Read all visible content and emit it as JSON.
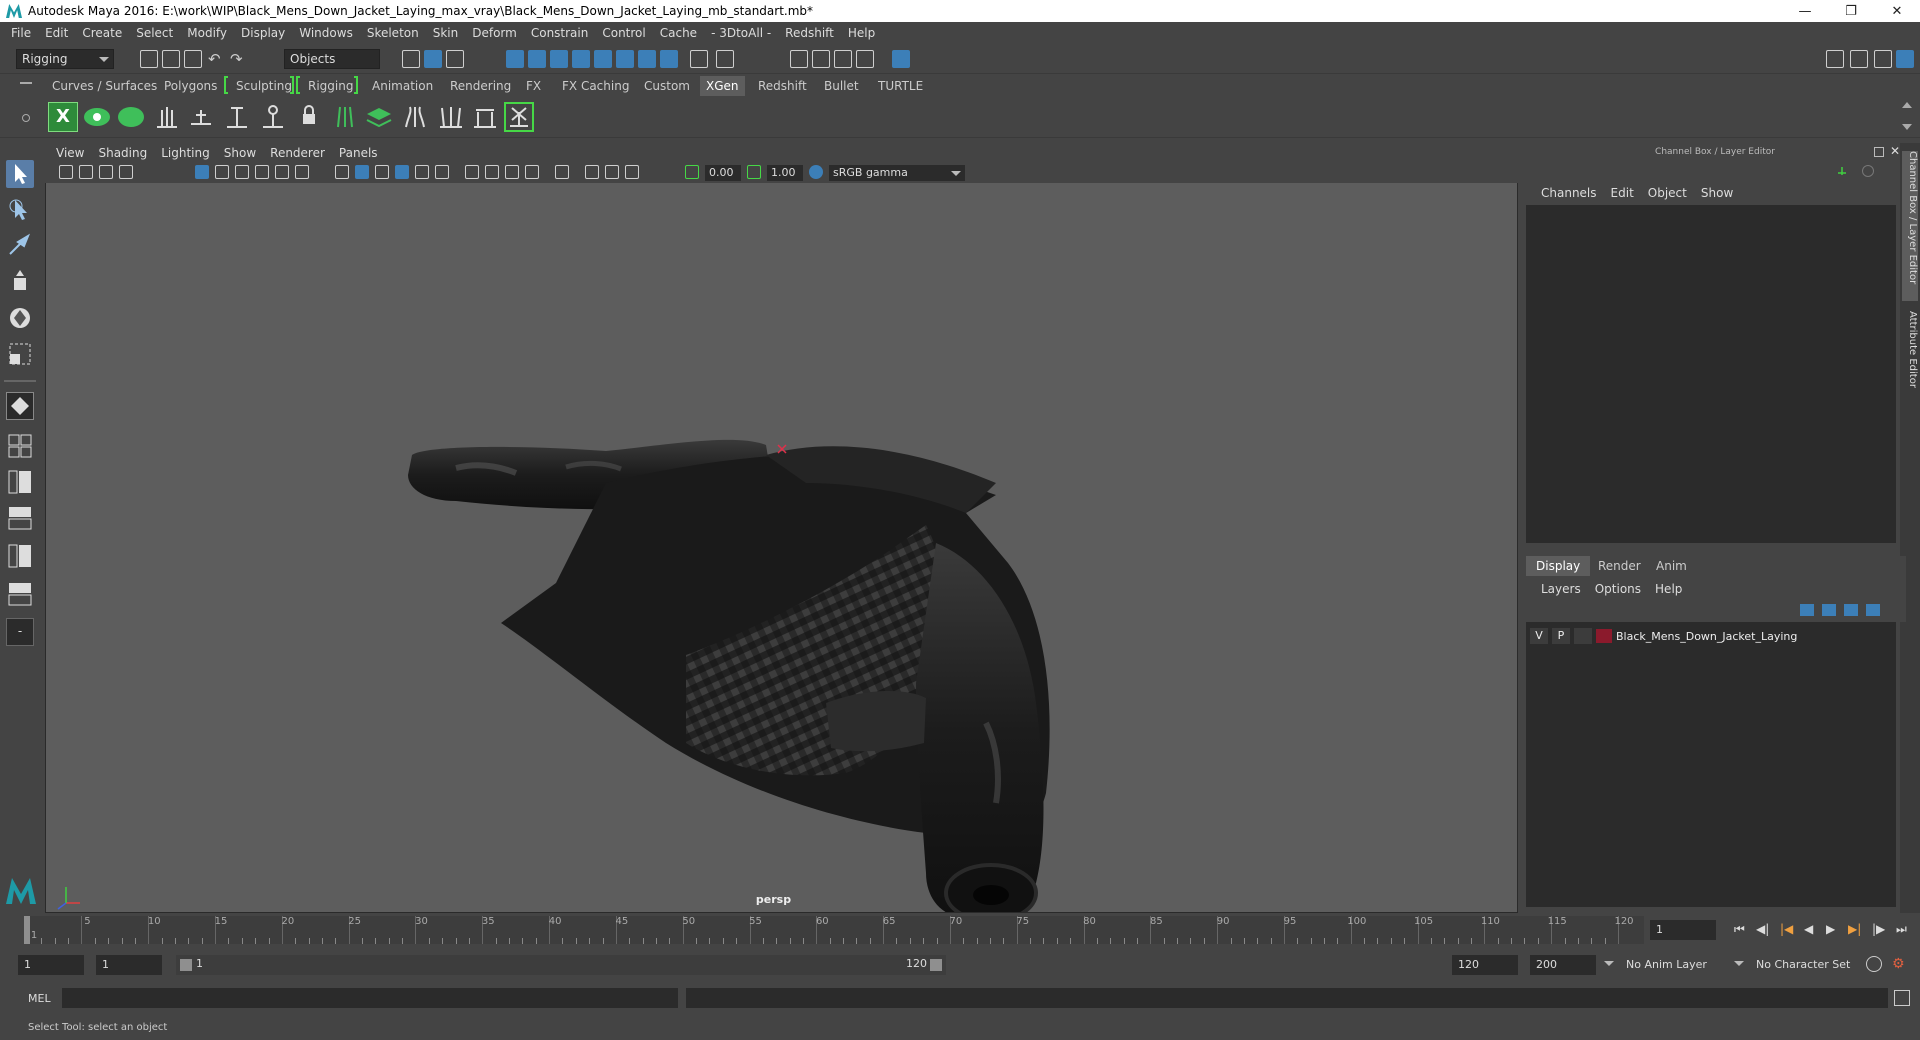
{
  "window": {
    "title": "Autodesk Maya 2016: E:\\work\\WIP\\Black_Mens_Down_Jacket_Laying_max_vray\\Black_Mens_Down_Jacket_Laying_mb_standart.mb*"
  },
  "menubar": [
    "File",
    "Edit",
    "Create",
    "Select",
    "Modify",
    "Display",
    "Windows",
    "Skeleton",
    "Skin",
    "Deform",
    "Constrain",
    "Control",
    "Cache",
    "- 3DtoAll -",
    "Redshift",
    "Help"
  ],
  "statusline": {
    "menuset": "Rigging",
    "selection_mode": "Objects"
  },
  "shelf_tabs": [
    "Curves / Surfaces",
    "Polygons",
    "Sculpting",
    "Rigging",
    "Animation",
    "Rendering",
    "FX",
    "FX Caching",
    "Custom",
    "XGen",
    "Redshift",
    "Bullet",
    "TURTLE"
  ],
  "shelf_active_tab": "XGen",
  "viewport": {
    "menu": [
      "View",
      "Shading",
      "Lighting",
      "Show",
      "Renderer",
      "Panels"
    ],
    "exposure": "0.00",
    "gamma": "1.00",
    "color_space": "sRGB gamma",
    "camera_label": "persp"
  },
  "channel_box": {
    "title": "Channel Box / Layer Editor",
    "menu": [
      "Channels",
      "Edit",
      "Object",
      "Show"
    ],
    "side_tabs": [
      "Channel Box / Layer Editor",
      "Attribute Editor"
    ]
  },
  "layer_editor": {
    "tabs": [
      "Display",
      "Render",
      "Anim"
    ],
    "active_tab": "Display",
    "menu": [
      "Layers",
      "Options",
      "Help"
    ],
    "layers": [
      {
        "v": "V",
        "p": "P",
        "name": "Black_Mens_Down_Jacket_Laying",
        "color": "#8b1a2c"
      }
    ]
  },
  "timeline": {
    "labels": [
      "1",
      "5",
      "10",
      "15",
      "20",
      "25",
      "30",
      "35",
      "40",
      "45",
      "50",
      "55",
      "60",
      "65",
      "70",
      "75",
      "80",
      "85",
      "90",
      "95",
      "100",
      "105",
      "110",
      "115",
      "120"
    ],
    "current_frame": "1"
  },
  "range": {
    "start_time": "1",
    "playback_start": "1",
    "slider_start": "1",
    "slider_end": "120",
    "playback_end": "120",
    "end_time": "200",
    "anim_layer": "No Anim Layer",
    "character_set": "No Character Set"
  },
  "command_line": {
    "label": "MEL"
  },
  "help_line": "Select Tool: select an object",
  "colors": {
    "accent_green": "#46d846",
    "accent_blue": "#3c7fb8",
    "viewport_bg": "#5d5d5d"
  }
}
